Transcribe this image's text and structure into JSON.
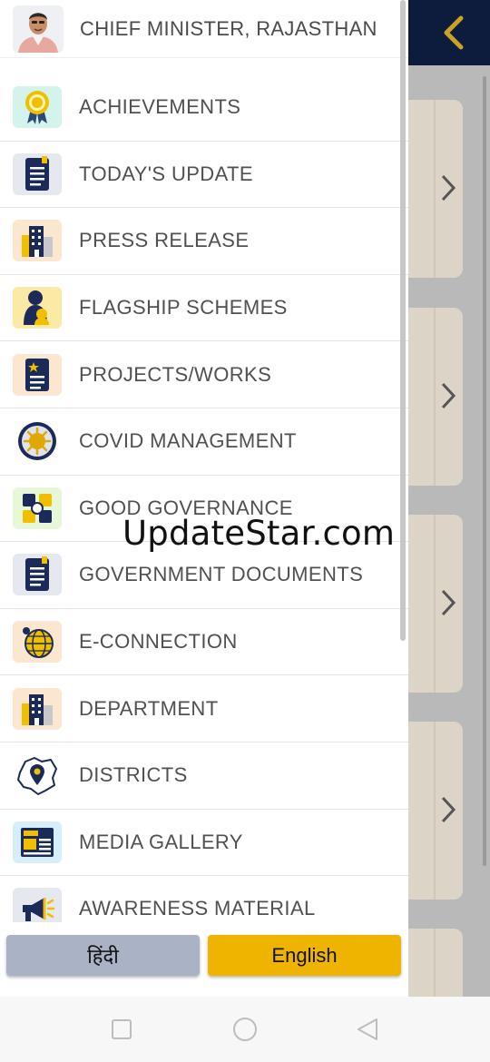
{
  "colors": {
    "header_bg": "#0d1b3d",
    "accent_yellow": "#efb400",
    "hindi_button": "#a9b3c5",
    "drawer_bg": "#ffffff"
  },
  "drawer": {
    "header": {
      "title": "CHIEF MINISTER, RAJASTHAN",
      "avatar_icon": "person-avatar"
    },
    "items": [
      {
        "label": "ACHIEVEMENTS",
        "icon": "award-medal-icon"
      },
      {
        "label": "TODAY'S UPDATE",
        "icon": "document-icon"
      },
      {
        "label": "PRESS RELEASE",
        "icon": "building-icon"
      },
      {
        "label": "FLAGSHIP SCHEMES",
        "icon": "mother-child-icon"
      },
      {
        "label": "PROJECTS/WORKS",
        "icon": "project-document-icon"
      },
      {
        "label": "COVID MANAGEMENT",
        "icon": "virus-icon"
      },
      {
        "label": "GOOD GOVERNANCE",
        "icon": "handshake-icon"
      },
      {
        "label": "GOVERNMENT DOCUMENTS",
        "icon": "document-icon"
      },
      {
        "label": "E-CONNECTION",
        "icon": "globe-icon"
      },
      {
        "label": "DEPARTMENT",
        "icon": "building-icon"
      },
      {
        "label": "DISTRICTS",
        "icon": "map-pin-icon"
      },
      {
        "label": "MEDIA GALLERY",
        "icon": "newspaper-icon"
      },
      {
        "label": "AWARENESS MATERIAL",
        "icon": "megaphone-icon"
      }
    ]
  },
  "language": {
    "hindi_label": "हिंदी",
    "english_label": "English"
  },
  "watermark": "UpdateStar.com",
  "nav_bar": {
    "buttons": [
      "recents-square-icon",
      "home-circle-icon",
      "back-triangle-icon"
    ]
  }
}
